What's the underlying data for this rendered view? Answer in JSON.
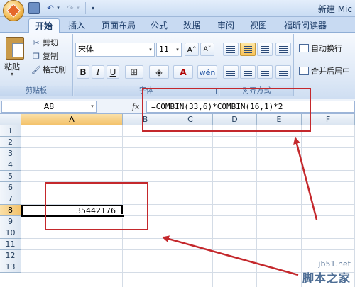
{
  "titlebar": {
    "title": "新建 Mic",
    "qat": {
      "undo": "↶",
      "dropdown": "▾",
      "redo": "↷",
      "customize": "▾"
    }
  },
  "tabs": [
    {
      "label": "开始",
      "active": true
    },
    {
      "label": "插入"
    },
    {
      "label": "页面布局"
    },
    {
      "label": "公式"
    },
    {
      "label": "数据"
    },
    {
      "label": "审阅"
    },
    {
      "label": "视图"
    },
    {
      "label": "福昕阅读器"
    }
  ],
  "ribbon": {
    "clipboard": {
      "paste": "粘贴",
      "paste_dropdown": "▾",
      "cut": "剪切",
      "copy": "复制",
      "format_painter": "格式刷",
      "group_label": "剪贴板",
      "cut_icon": "✂",
      "copy_icon": "❐",
      "painter_icon": "🖌"
    },
    "font": {
      "font_name": "宋体",
      "font_size": "11",
      "grow": "A˄",
      "shrink": "A˅",
      "bold": "B",
      "italic": "I",
      "underline": "U",
      "border": "⊞",
      "fill": "◈",
      "font_color": "A",
      "phonetic": "wén",
      "group_label": "字体",
      "dd": "▾"
    },
    "alignment": {
      "group_label": "对齐方式"
    },
    "wrap": {
      "wrap_text": "自动换行",
      "merge_center": "合并后居中"
    }
  },
  "formula_bar": {
    "name_box": "A8",
    "fx": "fx",
    "formula": "=COMBIN(33,6)*COMBIN(16,1)*2",
    "dd": "▾"
  },
  "sheet": {
    "columns": [
      "A",
      "B",
      "C",
      "D",
      "E",
      "F"
    ],
    "rows": [
      "1",
      "2",
      "3",
      "4",
      "5",
      "6",
      "7",
      "8",
      "9",
      "10",
      "11",
      "12",
      "13"
    ],
    "selected_cell": {
      "ref": "A8",
      "value": "35442176"
    }
  },
  "annotation": {
    "color": "#c4282c"
  },
  "watermark": {
    "url": "jb51.net",
    "name": "脚本之家"
  }
}
